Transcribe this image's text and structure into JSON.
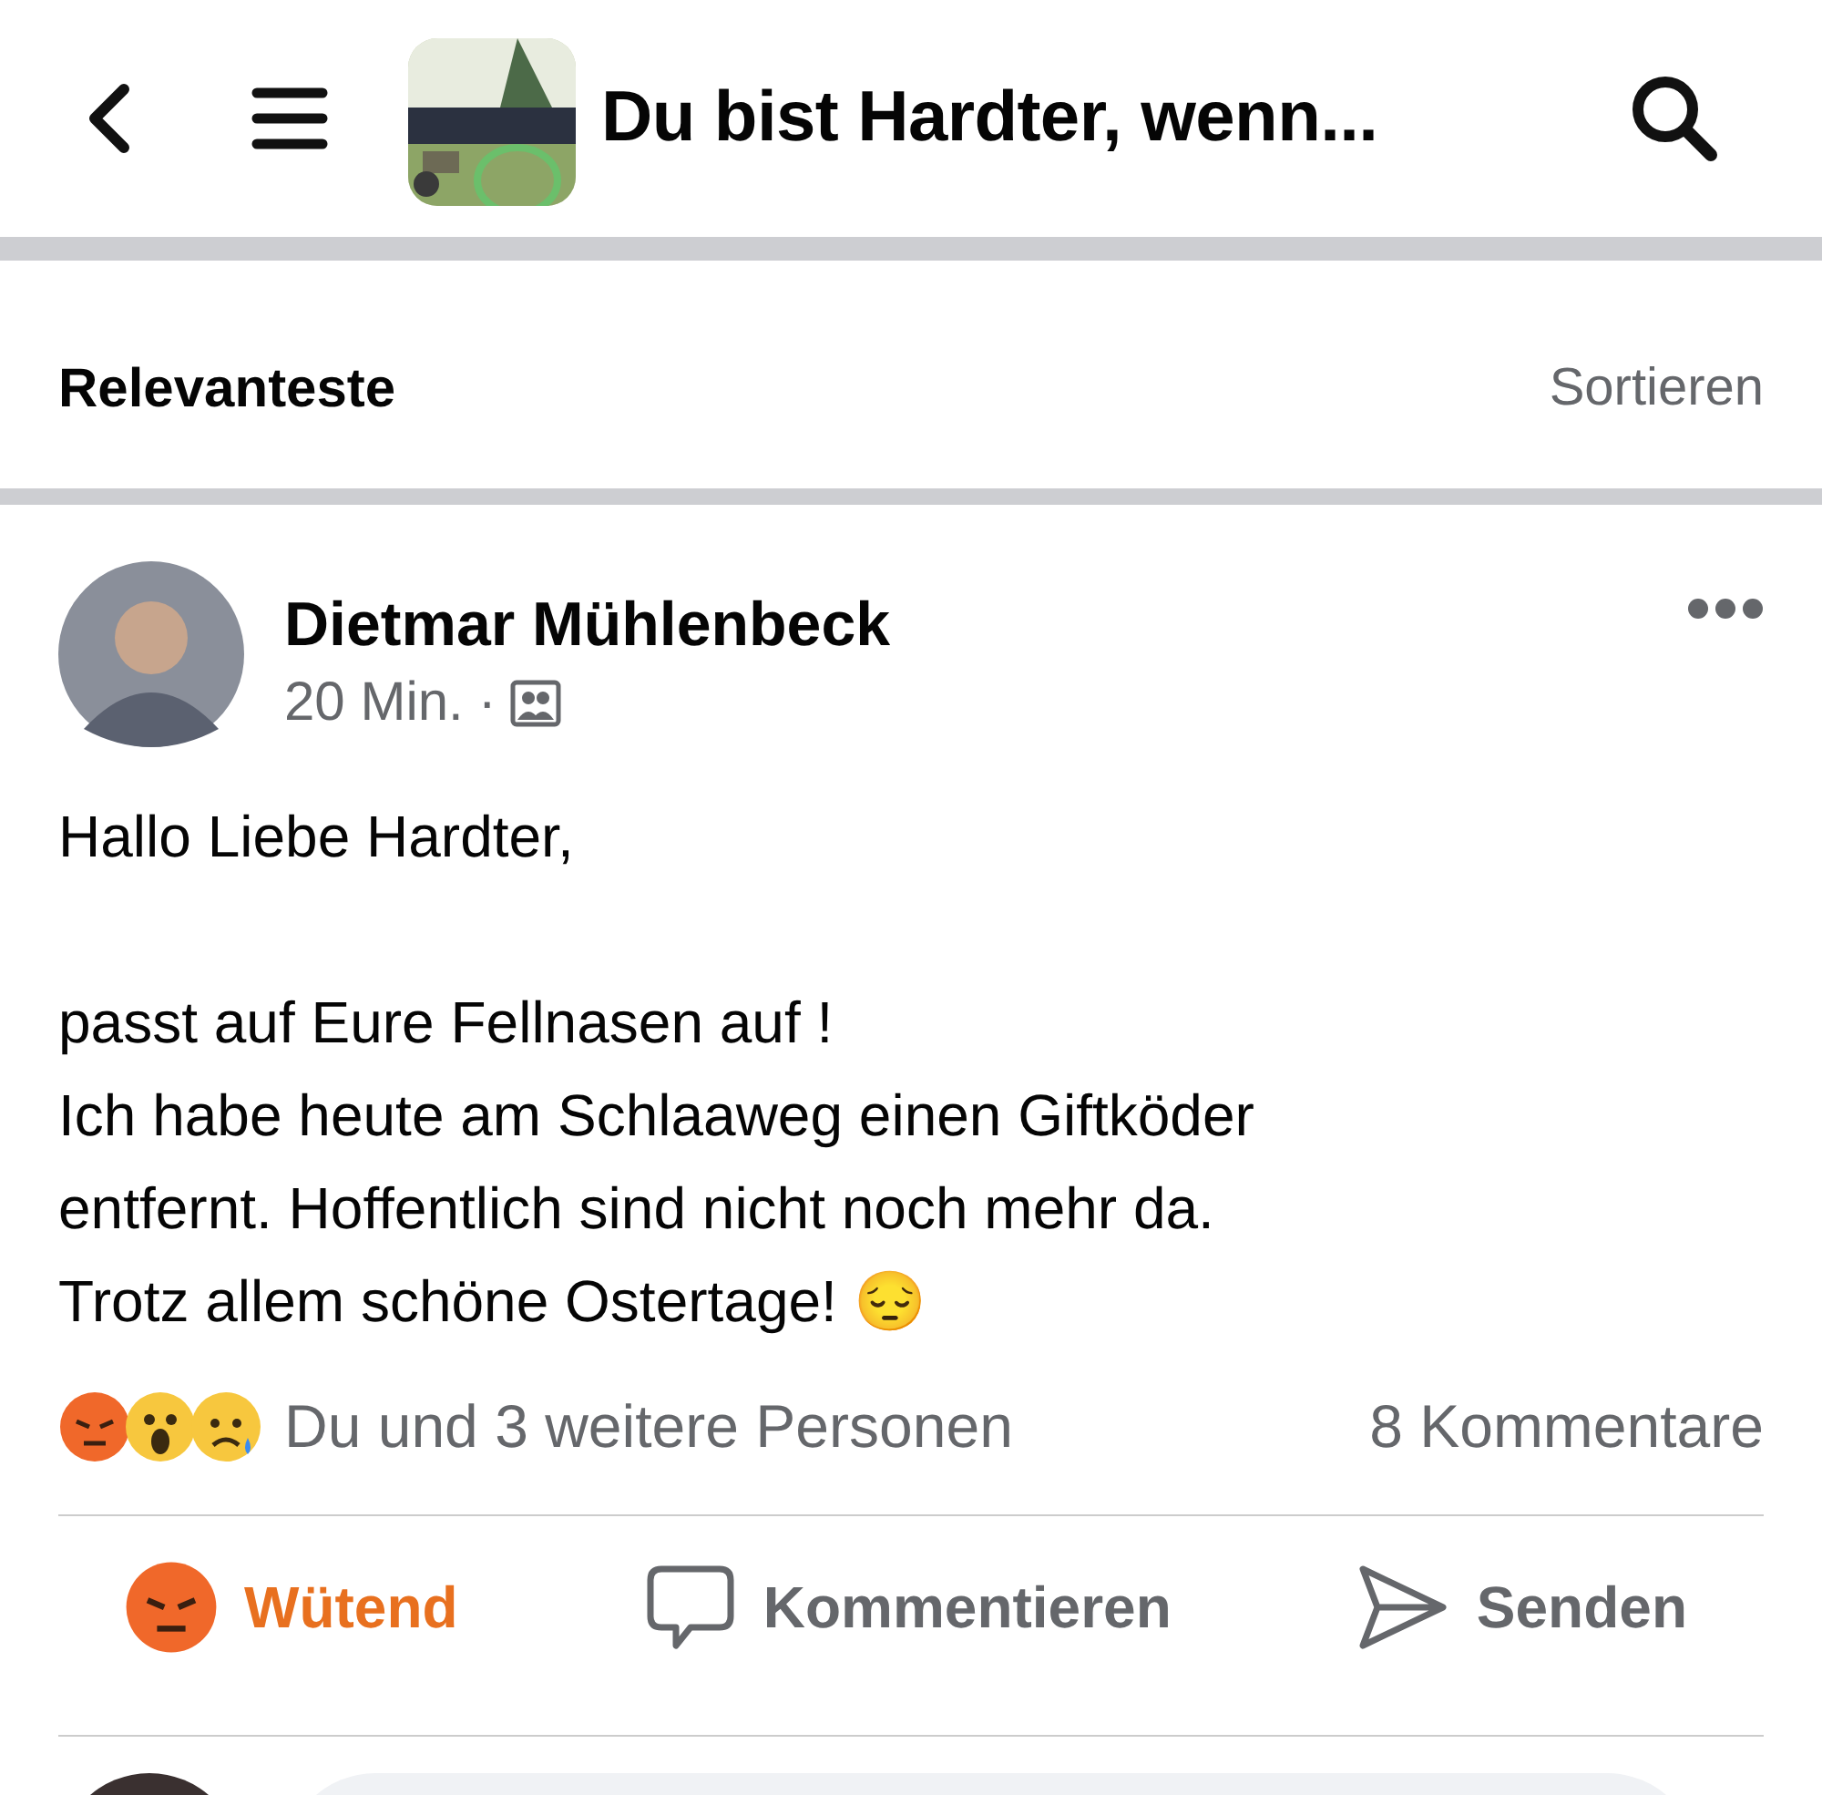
{
  "header": {
    "title": "Du bist Hardter, wenn..."
  },
  "sort_bar": {
    "label": "Relevanteste",
    "action": "Sortieren"
  },
  "post": {
    "author": "Dietmar Mühlenbeck",
    "time": "20 Min.",
    "separator": "·",
    "paragraphs": [
      {
        "lines": [
          "Hallo Liebe Hardter,"
        ]
      },
      {
        "lines": [
          "passt auf Eure Fellnasen auf !",
          "Ich habe heute am Schlaaweg einen Giftköder",
          "entfernt. Hoffentlich sind nicht noch mehr da.",
          "Trotz allem schöne Ostertage! 😔"
        ]
      }
    ],
    "reactions": {
      "icons": [
        {
          "kind": "angry"
        },
        {
          "kind": "wow"
        },
        {
          "kind": "sad"
        }
      ],
      "summary": "Du und 3 weitere Personen",
      "comments": "8 Kommentare"
    },
    "actions": [
      {
        "kind": "angry",
        "label": "Wütend",
        "selected": true
      },
      {
        "kind": "comment",
        "label": "Kommentieren",
        "selected": false
      },
      {
        "kind": "send",
        "label": "Senden",
        "selected": false
      }
    ]
  }
}
